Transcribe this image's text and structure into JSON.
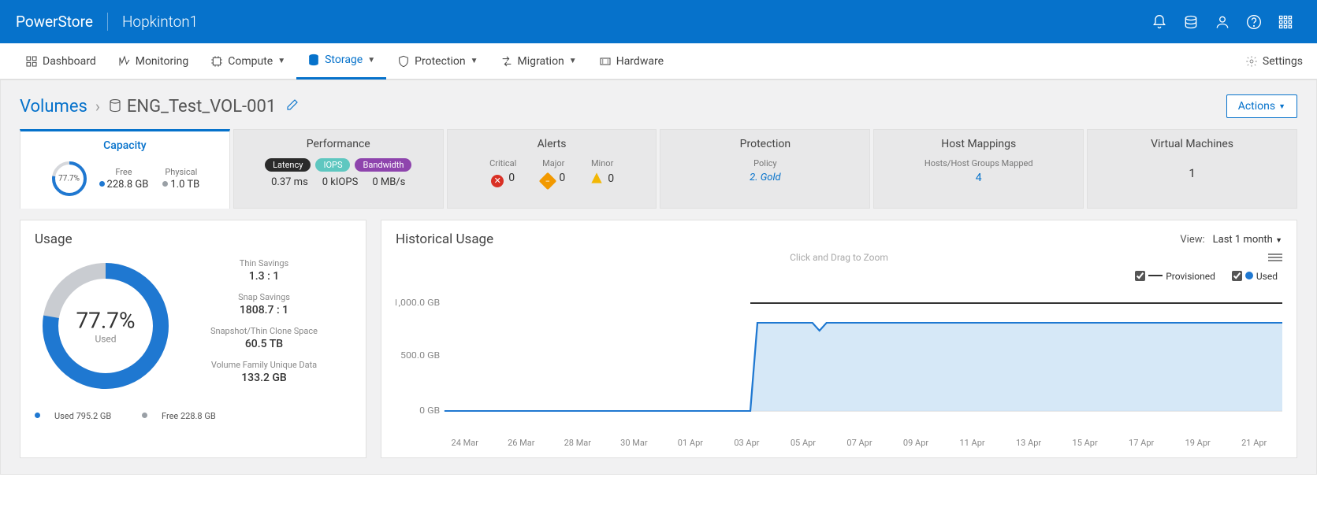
{
  "header": {
    "brand": "PowerStore",
    "cluster": "Hopkinton1"
  },
  "nav": {
    "items": [
      {
        "label": "Dashboard",
        "dropdown": false
      },
      {
        "label": "Monitoring",
        "dropdown": false
      },
      {
        "label": "Compute",
        "dropdown": true
      },
      {
        "label": "Storage",
        "dropdown": true
      },
      {
        "label": "Protection",
        "dropdown": true
      },
      {
        "label": "Migration",
        "dropdown": true
      },
      {
        "label": "Hardware",
        "dropdown": false
      }
    ],
    "settings_label": "Settings"
  },
  "breadcrumb": {
    "root": "Volumes",
    "volume_name": "ENG_Test_VOL-001",
    "actions_label": "Actions"
  },
  "tabs": {
    "capacity": {
      "title": "Capacity",
      "percent": "77.7%",
      "free_label": "Free",
      "free_value": "228.8 GB",
      "physical_label": "Physical",
      "physical_value": "1.0 TB"
    },
    "performance": {
      "title": "Performance",
      "latency_pill": "Latency",
      "iops_pill": "IOPS",
      "bandwidth_pill": "Bandwidth",
      "latency_val": "0.37 ms",
      "iops_val": "0 kIOPS",
      "bw_val": "0 MB/s"
    },
    "alerts": {
      "title": "Alerts",
      "critical_label": "Critical",
      "critical_val": "0",
      "major_label": "Major",
      "major_val": "0",
      "minor_label": "Minor",
      "minor_val": "0"
    },
    "protection": {
      "title": "Protection",
      "policy_label": "Policy",
      "policy_value": "2. Gold"
    },
    "host": {
      "title": "Host Mappings",
      "label": "Hosts/Host Groups Mapped",
      "value": "4"
    },
    "vm": {
      "title": "Virtual Machines",
      "value": "1"
    }
  },
  "usage_panel": {
    "title": "Usage",
    "percent": "77.7%",
    "percent_label": "Used",
    "thin_label": "Thin Savings",
    "thin_val": "1.3 : 1",
    "snap_label": "Snap Savings",
    "snap_val": "1808.7 : 1",
    "snapshot_label": "Snapshot/Thin Clone Space",
    "snapshot_val": "60.5 TB",
    "unique_label": "Volume Family Unique Data",
    "unique_val": "133.2 GB",
    "legend_used": "Used 795.2 GB",
    "legend_free": "Free 228.8 GB"
  },
  "hist_panel": {
    "title": "Historical Usage",
    "view_label": "View:",
    "view_value": "Last 1 month",
    "drag_hint": "Click and Drag to Zoom",
    "legend_prov": "Provisioned",
    "legend_used": "Used",
    "y_ticks": [
      "1,000.0 GB",
      "500.0 GB",
      "0 GB"
    ],
    "x_ticks": [
      "24 Mar",
      "26 Mar",
      "28 Mar",
      "30 Mar",
      "01 Apr",
      "03 Apr",
      "05 Apr",
      "07 Apr",
      "09 Apr",
      "11 Apr",
      "13 Apr",
      "15 Apr",
      "17 Apr",
      "19 Apr",
      "21 Apr"
    ]
  },
  "chart_data": {
    "type": "line",
    "title": "Historical Usage",
    "xlabel": "",
    "ylabel": "GB",
    "ylim": [
      0,
      1000
    ],
    "categories": [
      "24 Mar",
      "26 Mar",
      "28 Mar",
      "30 Mar",
      "01 Apr",
      "03 Apr",
      "05 Apr",
      "07 Apr",
      "09 Apr",
      "11 Apr",
      "13 Apr",
      "15 Apr",
      "17 Apr",
      "19 Apr",
      "21 Apr"
    ],
    "series": [
      {
        "name": "Provisioned",
        "values": [
          null,
          null,
          null,
          null,
          null,
          null,
          1000,
          1000,
          1000,
          1000,
          1000,
          1000,
          1000,
          1000,
          1000
        ]
      },
      {
        "name": "Used",
        "values": [
          0,
          0,
          0,
          0,
          0,
          0,
          800,
          790,
          800,
          800,
          800,
          800,
          800,
          800,
          800
        ]
      }
    ]
  }
}
